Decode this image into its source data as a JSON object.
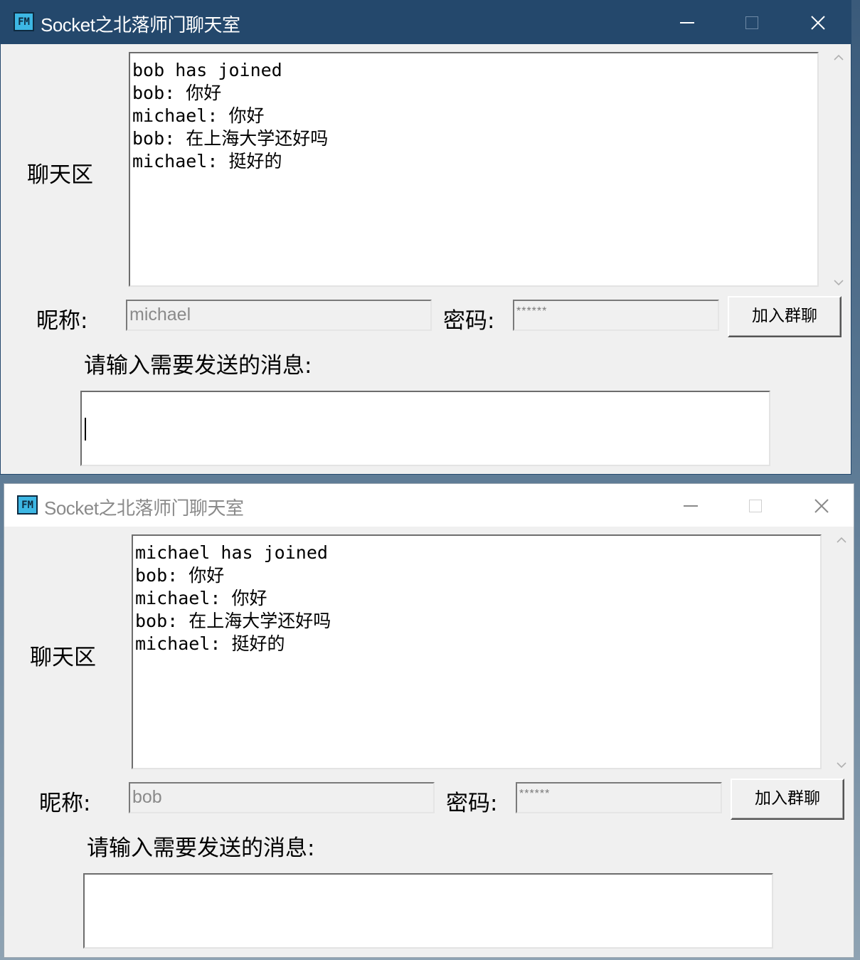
{
  "windows": [
    {
      "title": "Socket之北落师门聊天室",
      "icon_text": "FM",
      "chat_label": "聊天区",
      "chat_lines": [
        "bob has joined",
        "bob: 你好",
        "michael: 你好",
        "bob: 在上海大学还好吗",
        "michael: 挺好的"
      ],
      "nickname_label": "昵称:",
      "nickname_value": "michael",
      "password_label": "密码:",
      "password_value": "******",
      "join_button": "加入群聊",
      "message_prompt": "请输入需要发送的消息:",
      "message_value": "",
      "active": true
    },
    {
      "title": "Socket之北落师门聊天室",
      "icon_text": "FM",
      "chat_label": "聊天区",
      "chat_lines": [
        "michael has joined",
        "bob: 你好",
        "michael: 你好",
        "bob: 在上海大学还好吗",
        "michael: 挺好的"
      ],
      "nickname_label": "昵称:",
      "nickname_value": "bob",
      "password_label": "密码:",
      "password_value": "******",
      "join_button": "加入群聊",
      "message_prompt": "请输入需要发送的消息:",
      "message_value": "",
      "active": false
    }
  ],
  "colors": {
    "active_titlebar": "#24486c",
    "inactive_titlebar": "#ffffff",
    "window_bg": "#f0f0f0",
    "icon_bg": "#3db7e4"
  },
  "icons": [
    "app-fm-icon",
    "minimize-icon",
    "maximize-icon",
    "close-icon",
    "scroll-up-icon",
    "scroll-down-icon"
  ]
}
